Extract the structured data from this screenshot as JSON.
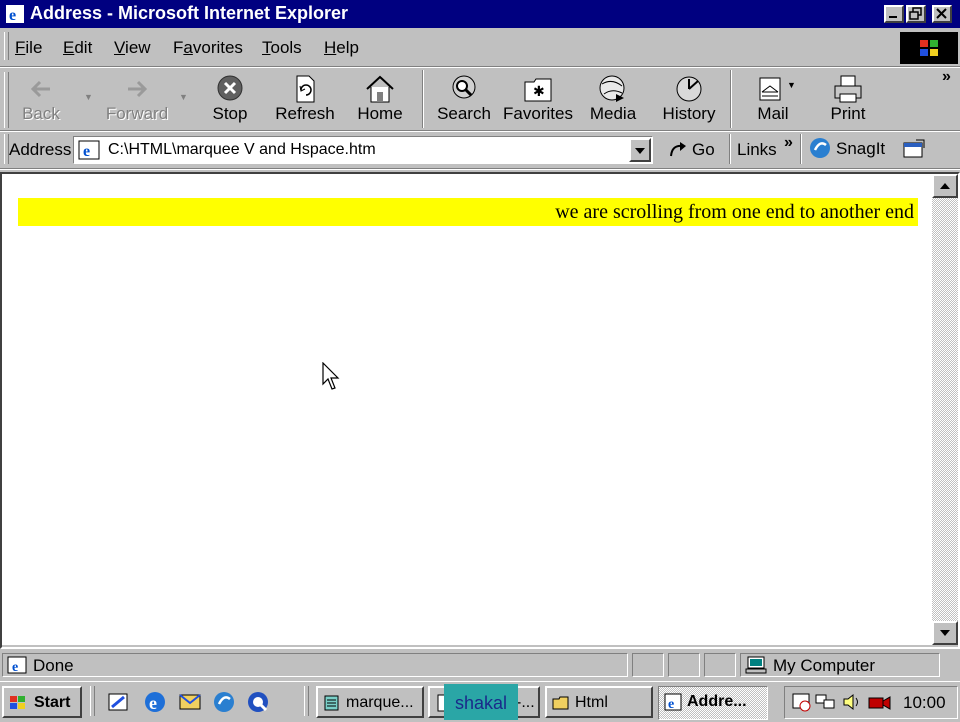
{
  "window": {
    "title": "Address - Microsoft Internet Explorer"
  },
  "menu": [
    {
      "label": "File",
      "accel": "F",
      "rest": "ile"
    },
    {
      "label": "Edit",
      "accel": "E",
      "rest": "dit"
    },
    {
      "label": "View",
      "accel": "V",
      "rest": "iew"
    },
    {
      "label": "Favorites",
      "accel": "a",
      "pre": "F",
      "rest": "vorites"
    },
    {
      "label": "Tools",
      "accel": "T",
      "rest": "ools"
    },
    {
      "label": "Help",
      "accel": "H",
      "rest": "elp"
    }
  ],
  "toolbar": {
    "back": "Back",
    "forward": "Forward",
    "stop": "Stop",
    "refresh": "Refresh",
    "home": "Home",
    "search": "Search",
    "favorites": "Favorites",
    "media": "Media",
    "history": "History",
    "mail": "Mail",
    "print": "Print",
    "chevron": "»"
  },
  "address_bar": {
    "label": "Address",
    "value": "C:\\HTML\\marquee V and Hspace.htm",
    "go": "Go",
    "links": "Links",
    "links_chevron": "»",
    "snagit": "SnagIt"
  },
  "page": {
    "marquee_text": "we are scrolling from one end to another end",
    "marquee_bg": "#ffff00"
  },
  "status": {
    "text": "Done",
    "zone": "My Computer"
  },
  "taskbar": {
    "start": "Start",
    "tasks": [
      {
        "label": "marque..."
      },
      {
        "label": "-..."
      },
      {
        "label": "Html"
      },
      {
        "label": "Addre..."
      }
    ],
    "overlay_label": "shakal",
    "clock": "10:00"
  },
  "colors": {
    "titlebar": "#000080",
    "face": "#c0c0c0",
    "marquee": "#ffff00"
  }
}
